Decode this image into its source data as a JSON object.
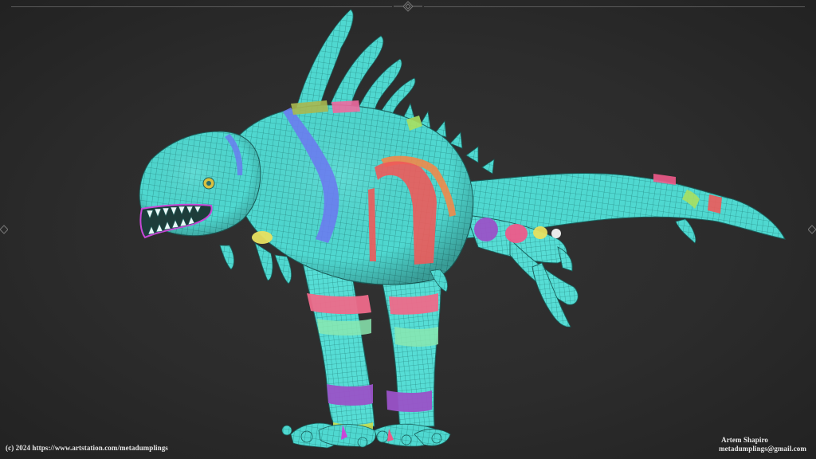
{
  "image": {
    "subject": "creature-3d-model-topology-render",
    "colors": {
      "background": "#2b2b2b",
      "mesh_base": "#4fd8d0",
      "mesh_line": "#1f6f6b",
      "uv_blue": "#6a7cf0",
      "uv_orange": "#f08a4a",
      "uv_red": "#ee5a5a",
      "uv_pink": "#f0608a",
      "uv_green": "#6ee8a0",
      "uv_purple": "#9a52c8",
      "uv_magenta": "#c848d8",
      "uv_yellow": "#e8e060",
      "uv_olive": "#a8b850"
    }
  },
  "credits": {
    "copyright": "(c) 2024 https://www.artstation.com/metadumplings",
    "author_name": "Artem Shapiro",
    "author_email": "metadumplings@gmail.com"
  }
}
